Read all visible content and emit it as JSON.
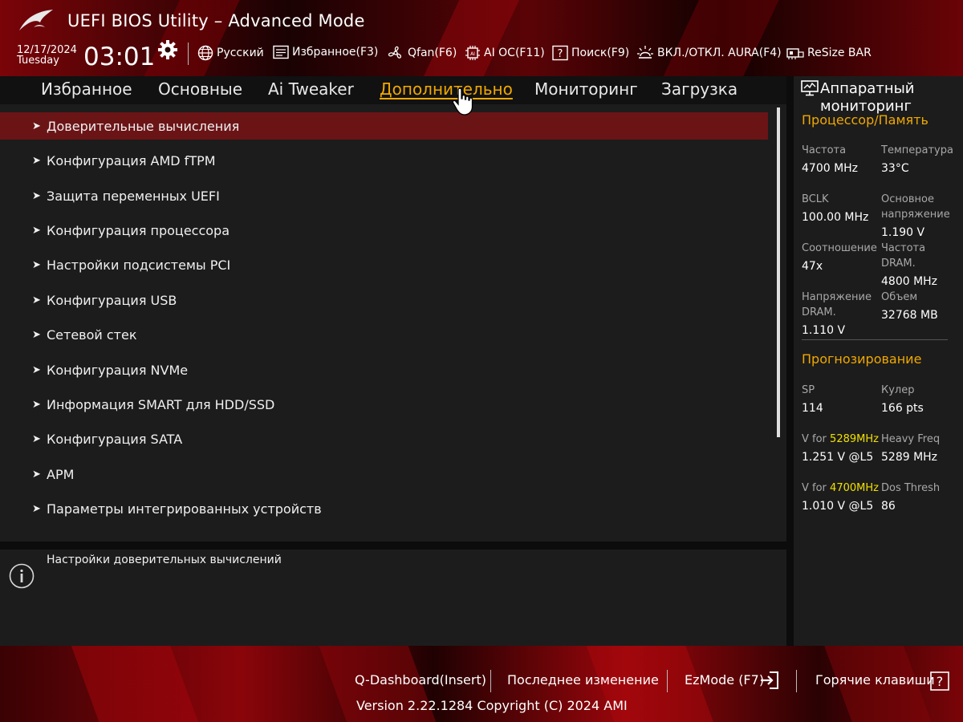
{
  "header": {
    "title": "UEFI BIOS Utility – Advanced Mode",
    "date": "12/17/2024",
    "day": "Tuesday",
    "time": "03:01",
    "tools": [
      {
        "label": "Русский",
        "icon": "globe-icon"
      },
      {
        "label": "Избранное(F3)",
        "icon": "favorites-icon"
      },
      {
        "label": "Qfan(F6)",
        "icon": "fan-icon"
      },
      {
        "label": "AI OC(F11)",
        "icon": "chip-icon"
      },
      {
        "label": "Поиск(F9)",
        "icon": "search-help-icon"
      },
      {
        "label": "ВКЛ./ОТКЛ. AURA(F4)",
        "icon": "aura-icon"
      },
      {
        "label": "ReSize BAR",
        "icon": "resize-bar-icon"
      }
    ]
  },
  "tabs": [
    {
      "label": "Избранное"
    },
    {
      "label": "Основные"
    },
    {
      "label": "Ai Tweaker"
    },
    {
      "label": "Дополнительно",
      "active": true
    },
    {
      "label": "Мониторинг"
    },
    {
      "label": "Загрузка"
    }
  ],
  "menu": {
    "items": [
      {
        "label": "Доверительные вычисления",
        "selected": true
      },
      {
        "label": "Конфигурация AMD fTPM"
      },
      {
        "label": "Защита переменных UEFI"
      },
      {
        "label": "Конфигурация процессора"
      },
      {
        "label": "Настройки подсистемы PCI"
      },
      {
        "label": "Конфигурация USB"
      },
      {
        "label": "Сетевой стек"
      },
      {
        "label": "Конфигурация NVMe"
      },
      {
        "label": "Информация SMART для HDD/SSD"
      },
      {
        "label": "Конфигурация SATA"
      },
      {
        "label": "APM"
      },
      {
        "label": "Параметры интегрированных устройств"
      }
    ],
    "arrow": "➤"
  },
  "help": {
    "text": "Настройки доверительных вычислений"
  },
  "monitor": {
    "title": "Аппаратный мониторинг",
    "cpu_section": "Процессор/Память",
    "freq_label": "Частота",
    "freq_value": "4700 MHz",
    "temp_label": "Температура",
    "temp_value": "33°C",
    "bclk_label": "BCLK",
    "bclk_value": "100.00 MHz",
    "core_v_label_1": "Основное",
    "core_v_label_2": "напряжение",
    "core_v_value": "1.190 V",
    "ratio_label": "Соотношение",
    "ratio_value": "47x",
    "dram_freq_label_1": "Частота",
    "dram_freq_label_2": "DRAM.",
    "dram_freq_value": "4800 MHz",
    "dram_v_label_1": "Напряжение",
    "dram_v_label_2": "DRAM.",
    "dram_v_value": "1.110 V",
    "capacity_label": "Объем",
    "capacity_value": "32768 MB",
    "predict_section": "Прогнозирование",
    "sp_label": "SP",
    "sp_value": "114",
    "cooler_label": "Кулер",
    "cooler_value": "166 pts",
    "v_for_prefix": "V for",
    "v1_freq": "5289MHz",
    "v1_value": "1.251 V @L5",
    "heavy_label": "Heavy Freq",
    "heavy_value": "5289 MHz",
    "v2_freq": "4700MHz",
    "v2_value": "1.010 V @L5",
    "dos_label": "Dos Thresh",
    "dos_value": "86"
  },
  "footer": {
    "qdash": "Q-Dashboard(Insert)",
    "last_change": "Последнее изменение",
    "ezmode": "EzMode (F7)",
    "hotkeys": "Горячие клавиши",
    "version": "Version 2.22.1284 Copyright (C) 2024 AMI"
  },
  "colors": {
    "accent": "#f0a800",
    "selected_row": "#6b1416",
    "highlight": "#f0e000"
  }
}
